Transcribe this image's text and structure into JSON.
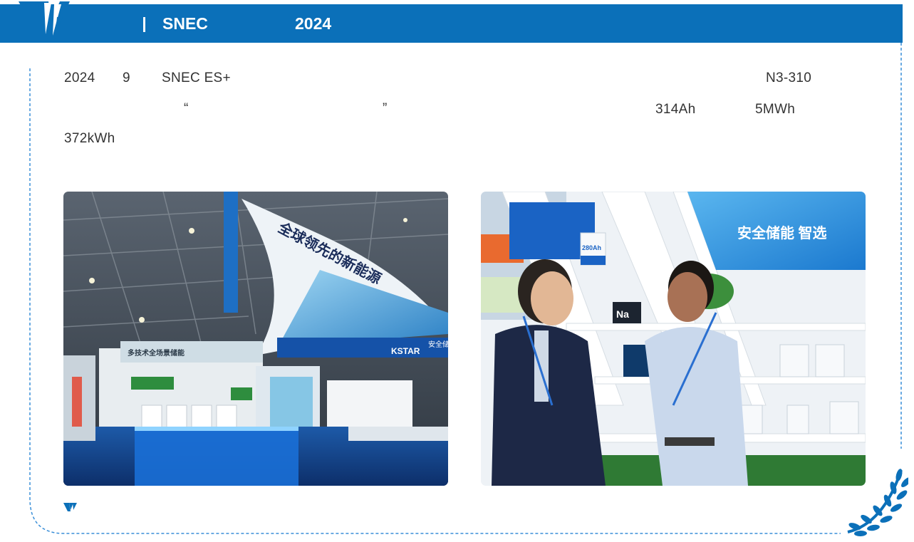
{
  "header": {
    "separator": "|",
    "event": "SNEC",
    "year": "2024"
  },
  "body": {
    "line1_year": "2024",
    "line1_month": "9",
    "line1_show": "SNEC ES+",
    "line1_booth": "N3-310",
    "line2_quote_open": "“",
    "line2_quote_close": "”",
    "line2_cell": "314Ah",
    "line2_capacity": "5MWh",
    "line3_capacity": "372kWh"
  },
  "photo1": {
    "banner_text": "全球领先的新能源",
    "booth_sign": "多技术全场景储能",
    "brand": "KSTAR",
    "panel_text": "安全储"
  },
  "photo2": {
    "banner_text": "安全储能 智选",
    "battery_label": "280Ah",
    "na_label": "Na"
  },
  "colors": {
    "brand_blue": "#0b70b9",
    "dashed_border": "#3a8fd8",
    "text": "#333333"
  }
}
